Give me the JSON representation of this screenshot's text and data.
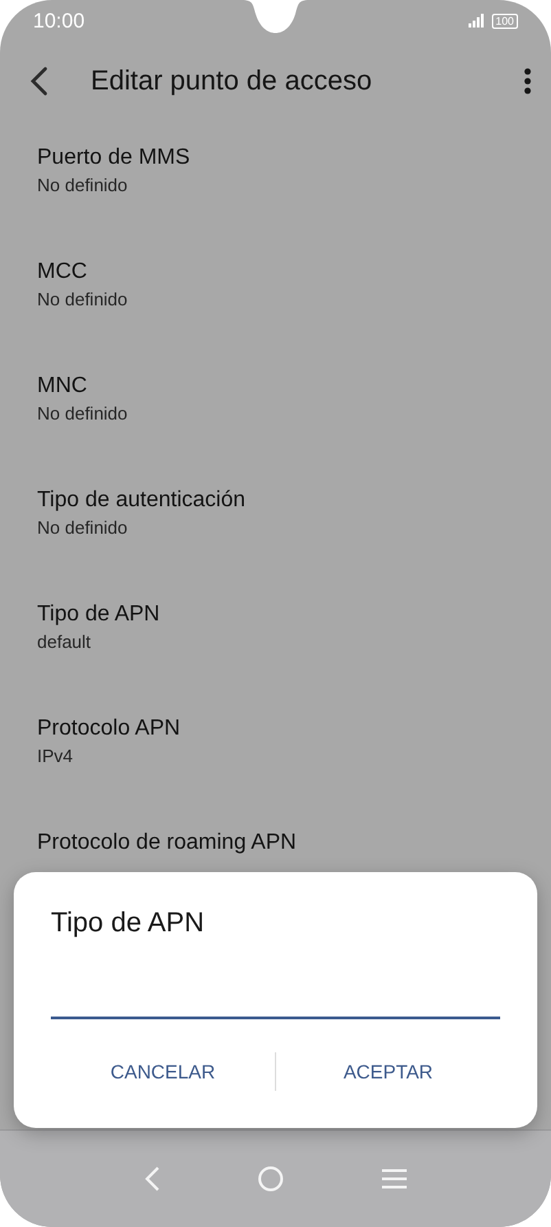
{
  "status_bar": {
    "time": "10:00",
    "battery": "100"
  },
  "header": {
    "title": "Editar punto de acceso"
  },
  "settings": [
    {
      "title": "Puerto de MMS",
      "value": "No definido"
    },
    {
      "title": "MCC",
      "value": "No definido"
    },
    {
      "title": "MNC",
      "value": "No definido"
    },
    {
      "title": "Tipo de autenticación",
      "value": "No definido"
    },
    {
      "title": "Tipo de APN",
      "value": "default"
    },
    {
      "title": "Protocolo APN",
      "value": "IPv4"
    },
    {
      "title": "Protocolo de roaming APN"
    }
  ],
  "dialog": {
    "title": "Tipo de APN",
    "buttons": [
      "CANCELAR",
      "ACEPTAR"
    ]
  }
}
